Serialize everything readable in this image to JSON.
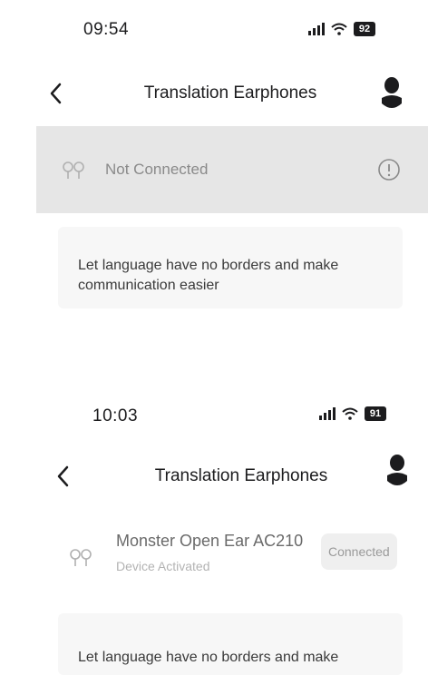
{
  "screenshot_1": {
    "status_bar": {
      "time": "09:54",
      "battery": "92"
    },
    "nav": {
      "title": "Translation Earphones"
    },
    "device": {
      "status": "Not Connected"
    },
    "promo": {
      "text": "Let language have no borders and make communication easier"
    }
  },
  "screenshot_2": {
    "status_bar": {
      "time": "10:03",
      "battery": "91"
    },
    "nav": {
      "title": "Translation Earphones"
    },
    "device": {
      "name": "Monster Open Ear AC210",
      "subtitle": "Device Activated",
      "badge": "Connected"
    },
    "promo": {
      "text": "Let language have no borders and make"
    }
  },
  "colors": {
    "disconnected_bar": "#e6e6e6",
    "card_background": "#f7f7f7",
    "badge_background": "#efefef",
    "text_primary": "#1c1c1e",
    "text_muted": "#8a8a8a"
  },
  "icons": [
    "chevron-left-icon",
    "user-icon",
    "earbuds-icon",
    "alert-circle-icon",
    "signal-icon",
    "wifi-icon",
    "battery-icon"
  ]
}
